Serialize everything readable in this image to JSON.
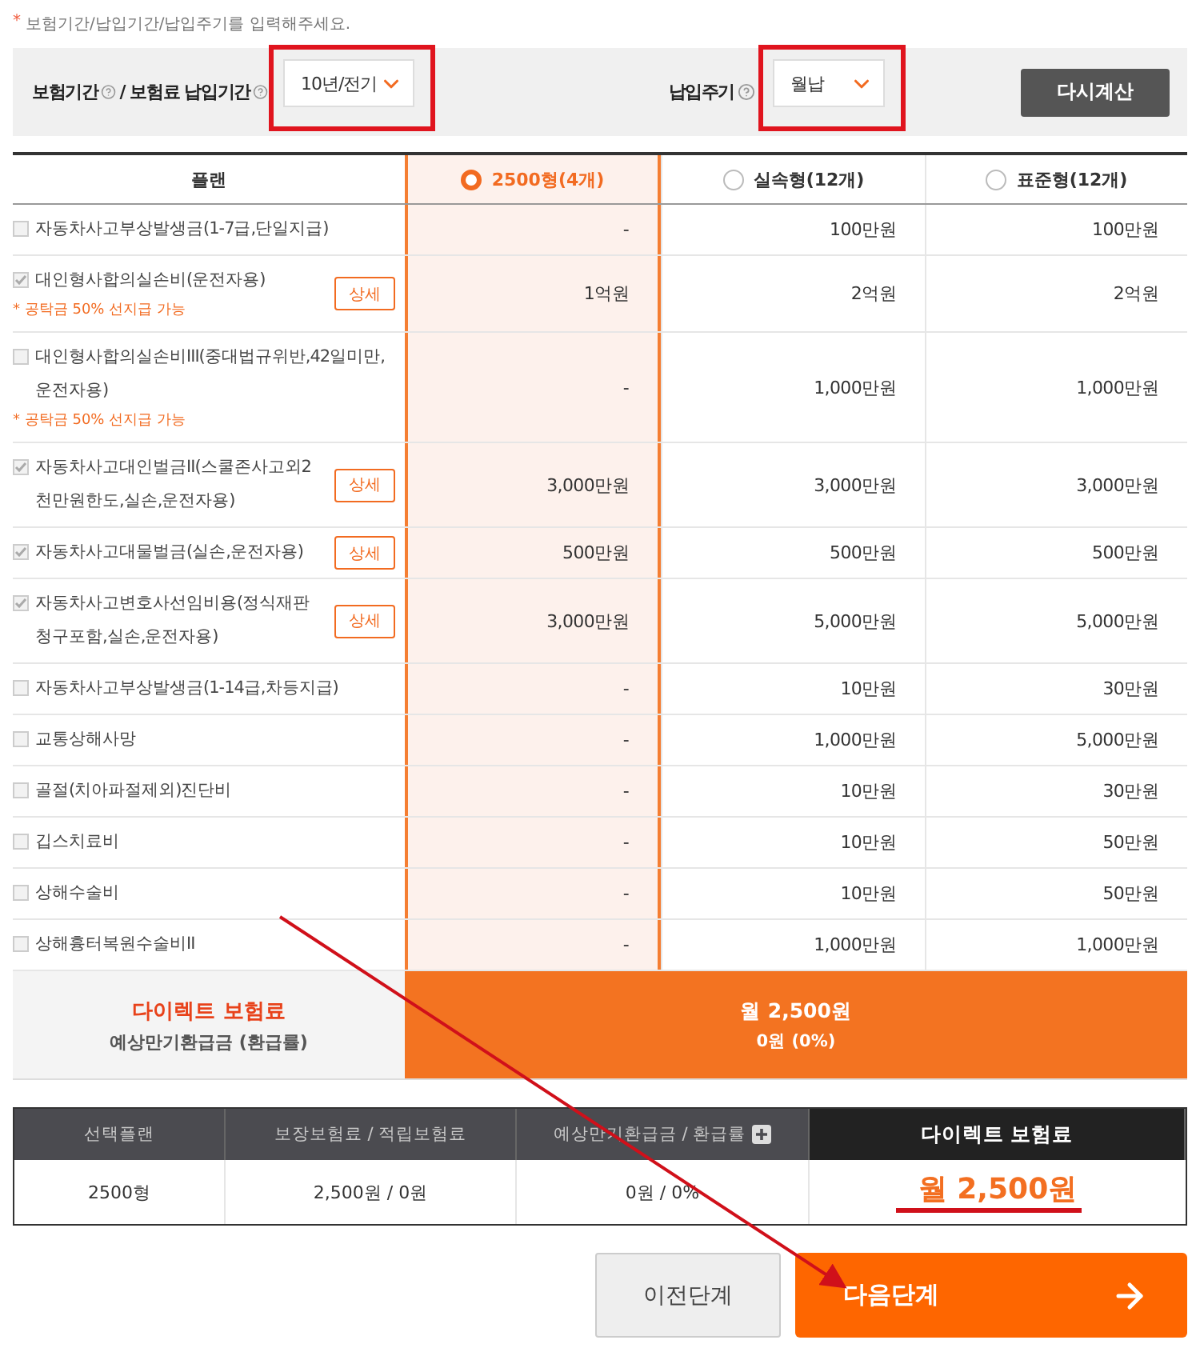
{
  "notice": {
    "mark": "*",
    "text": "보험기간/납입기간/납입주기를 입력해주세요."
  },
  "filters": [
    {
      "labels": [
        "보험기간",
        "/ 보험료 납입기간"
      ],
      "value": "10년/전기"
    },
    {
      "labels": [
        "납입주기"
      ],
      "value": "월납"
    }
  ],
  "recalc_button": "다시계산",
  "table": {
    "plan_header": "플랜",
    "plans": [
      {
        "label": "2500형(4개)",
        "selected": true
      },
      {
        "label": "실속형(12개)",
        "selected": false
      },
      {
        "label": "표준형(12개)",
        "selected": false
      }
    ],
    "rows": [
      {
        "name": "자동차사고부상발생금(1-7급,단일지급)",
        "checked": false,
        "values": [
          "-",
          "100만원",
          "100만원"
        ]
      },
      {
        "name": "대인형사합의실손비(운전자용)",
        "checked": true,
        "detail": "상세",
        "note": "* 공탁금 50% 선지급 가능",
        "values": [
          "1억원",
          "2억원",
          "2억원"
        ]
      },
      {
        "name": "대인형사합의실손비III(중대법규위반,42일미만,운전자용)",
        "checked": false,
        "note": "* 공탁금 50% 선지급 가능",
        "values": [
          "-",
          "1,000만원",
          "1,000만원"
        ]
      },
      {
        "name": "자동차사고대인벌금II(스쿨존사고외2천만원한도,실손,운전자용)",
        "checked": true,
        "detail": "상세",
        "values": [
          "3,000만원",
          "3,000만원",
          "3,000만원"
        ]
      },
      {
        "name": "자동차사고대물벌금(실손,운전자용)",
        "checked": true,
        "detail": "상세",
        "values": [
          "500만원",
          "500만원",
          "500만원"
        ]
      },
      {
        "name": "자동차사고변호사선임비용(정식재판청구포함,실손,운전자용)",
        "checked": true,
        "detail": "상세",
        "values": [
          "3,000만원",
          "5,000만원",
          "5,000만원"
        ]
      },
      {
        "name": "자동차사고부상발생금(1-14급,차등지급)",
        "checked": false,
        "values": [
          "-",
          "10만원",
          "30만원"
        ]
      },
      {
        "name": "교통상해사망",
        "checked": false,
        "values": [
          "-",
          "1,000만원",
          "5,000만원"
        ]
      },
      {
        "name": "골절(치아파절제외)진단비",
        "checked": false,
        "values": [
          "-",
          "10만원",
          "30만원"
        ]
      },
      {
        "name": "깁스치료비",
        "checked": false,
        "values": [
          "-",
          "10만원",
          "50만원"
        ]
      },
      {
        "name": "상해수술비",
        "checked": false,
        "values": [
          "-",
          "10만원",
          "50만원"
        ]
      },
      {
        "name": "상해흉터복원수술비II",
        "checked": false,
        "values": [
          "-",
          "1,000만원",
          "1,000만원"
        ]
      }
    ]
  },
  "premium_summary": {
    "labels": [
      "다이렉트 보험료",
      "예상만기환급금 (환급률)"
    ],
    "values": [
      "월 2,500원",
      "0원 (0%)"
    ]
  },
  "summary_table": {
    "columns": [
      "선택플랜",
      "보장보험료 / 적립보험료",
      "예상만기환급금 / 환급률",
      "다이렉트 보험료"
    ],
    "row": [
      "2500형",
      "2,500원 / 0원",
      "0원 / 0%",
      "월 2,500원"
    ]
  },
  "buttons": {
    "prev": "이전단계",
    "next": "다음단계"
  }
}
